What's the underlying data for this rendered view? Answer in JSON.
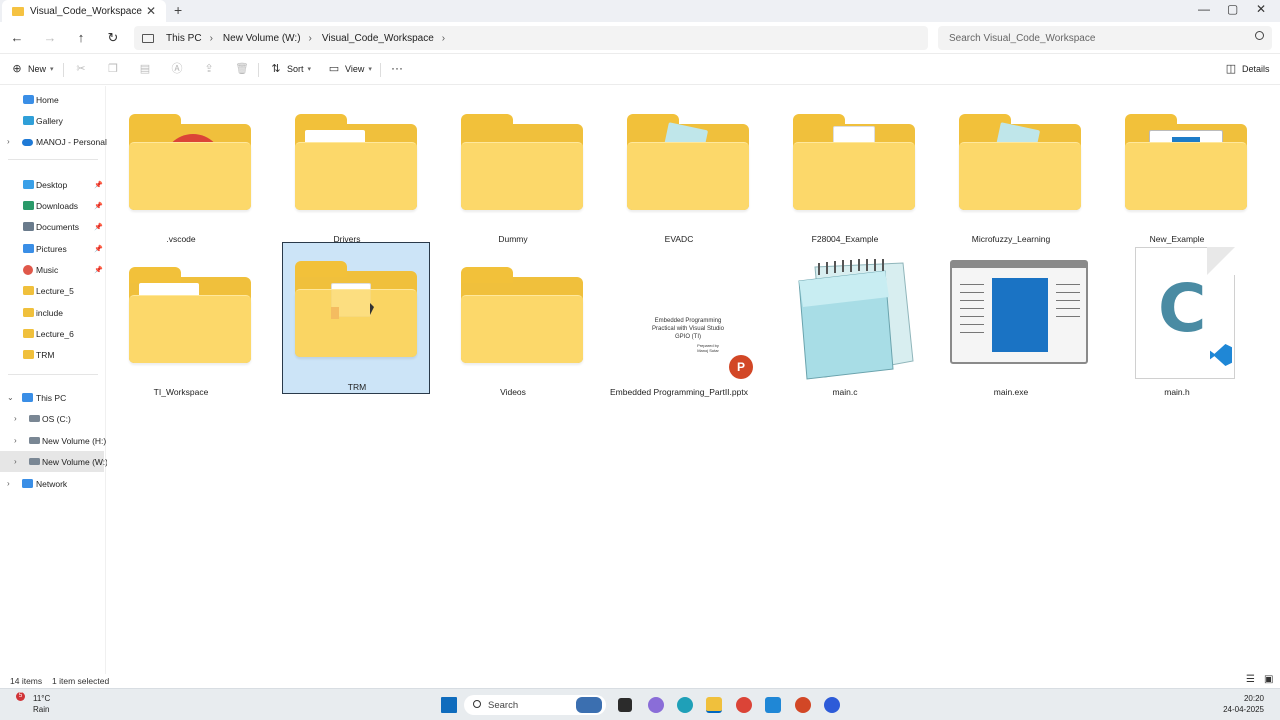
{
  "window": {
    "tab_title": "Visual_Code_Workspace",
    "tab_close": "✕",
    "new_tab": "+",
    "minimize": "—",
    "maximize": "▢",
    "close": "✕"
  },
  "nav": {
    "back": "←",
    "forward": "→",
    "up": "↑",
    "refresh": "↻"
  },
  "address": {
    "breadcrumbs": [
      "This PC",
      "New Volume (W:)",
      "Visual_Code_Workspace"
    ],
    "separator": "›"
  },
  "search": {
    "placeholder": "Search Visual_Code_Workspace"
  },
  "toolbar": {
    "new_label": "New",
    "sort_label": "Sort",
    "view_label": "View",
    "more": "···",
    "details_label": "Details"
  },
  "sidebar": {
    "home": "Home",
    "gallery": "Gallery",
    "onedrive": "MANOJ - Personal",
    "quick": [
      "Desktop",
      "Downloads",
      "Documents",
      "Pictures",
      "Music",
      "Lecture_5",
      "include",
      "Lecture_6",
      "TRM"
    ],
    "this_pc": "This PC",
    "drives": [
      "OS (C:)",
      "New Volume (H:)",
      "New Volume (W:)"
    ],
    "network": "Network"
  },
  "files": [
    ".vscode",
    "Drivers",
    "Dummy",
    "EVADC",
    "F28004_Example",
    "Microfuzzy_Learning",
    "New_Example",
    "TI_Workspace",
    "TRM",
    "Videos",
    "Embedded Programming_PartII.pptx",
    "main.c",
    "main.exe",
    "main.h"
  ],
  "pptx_preview": {
    "line1": "Embedded Programming",
    "line2": "Practical with Visual Studio",
    "line3": "GPIO (TI)",
    "small": "Prepared by\nManoj Sutar"
  },
  "status": {
    "count": "14 items",
    "selection": "1 item selected"
  },
  "taskbar": {
    "search_label": "Search",
    "temperature": "11°C",
    "weather": "Rain",
    "weather_badge": "5",
    "time": "20:20",
    "date": "24-04-2025"
  },
  "colors": {
    "folder": "#f0c03c",
    "folder_front": "#fcd86a",
    "selection": "#cce4f7",
    "accent": "#0067c0"
  }
}
